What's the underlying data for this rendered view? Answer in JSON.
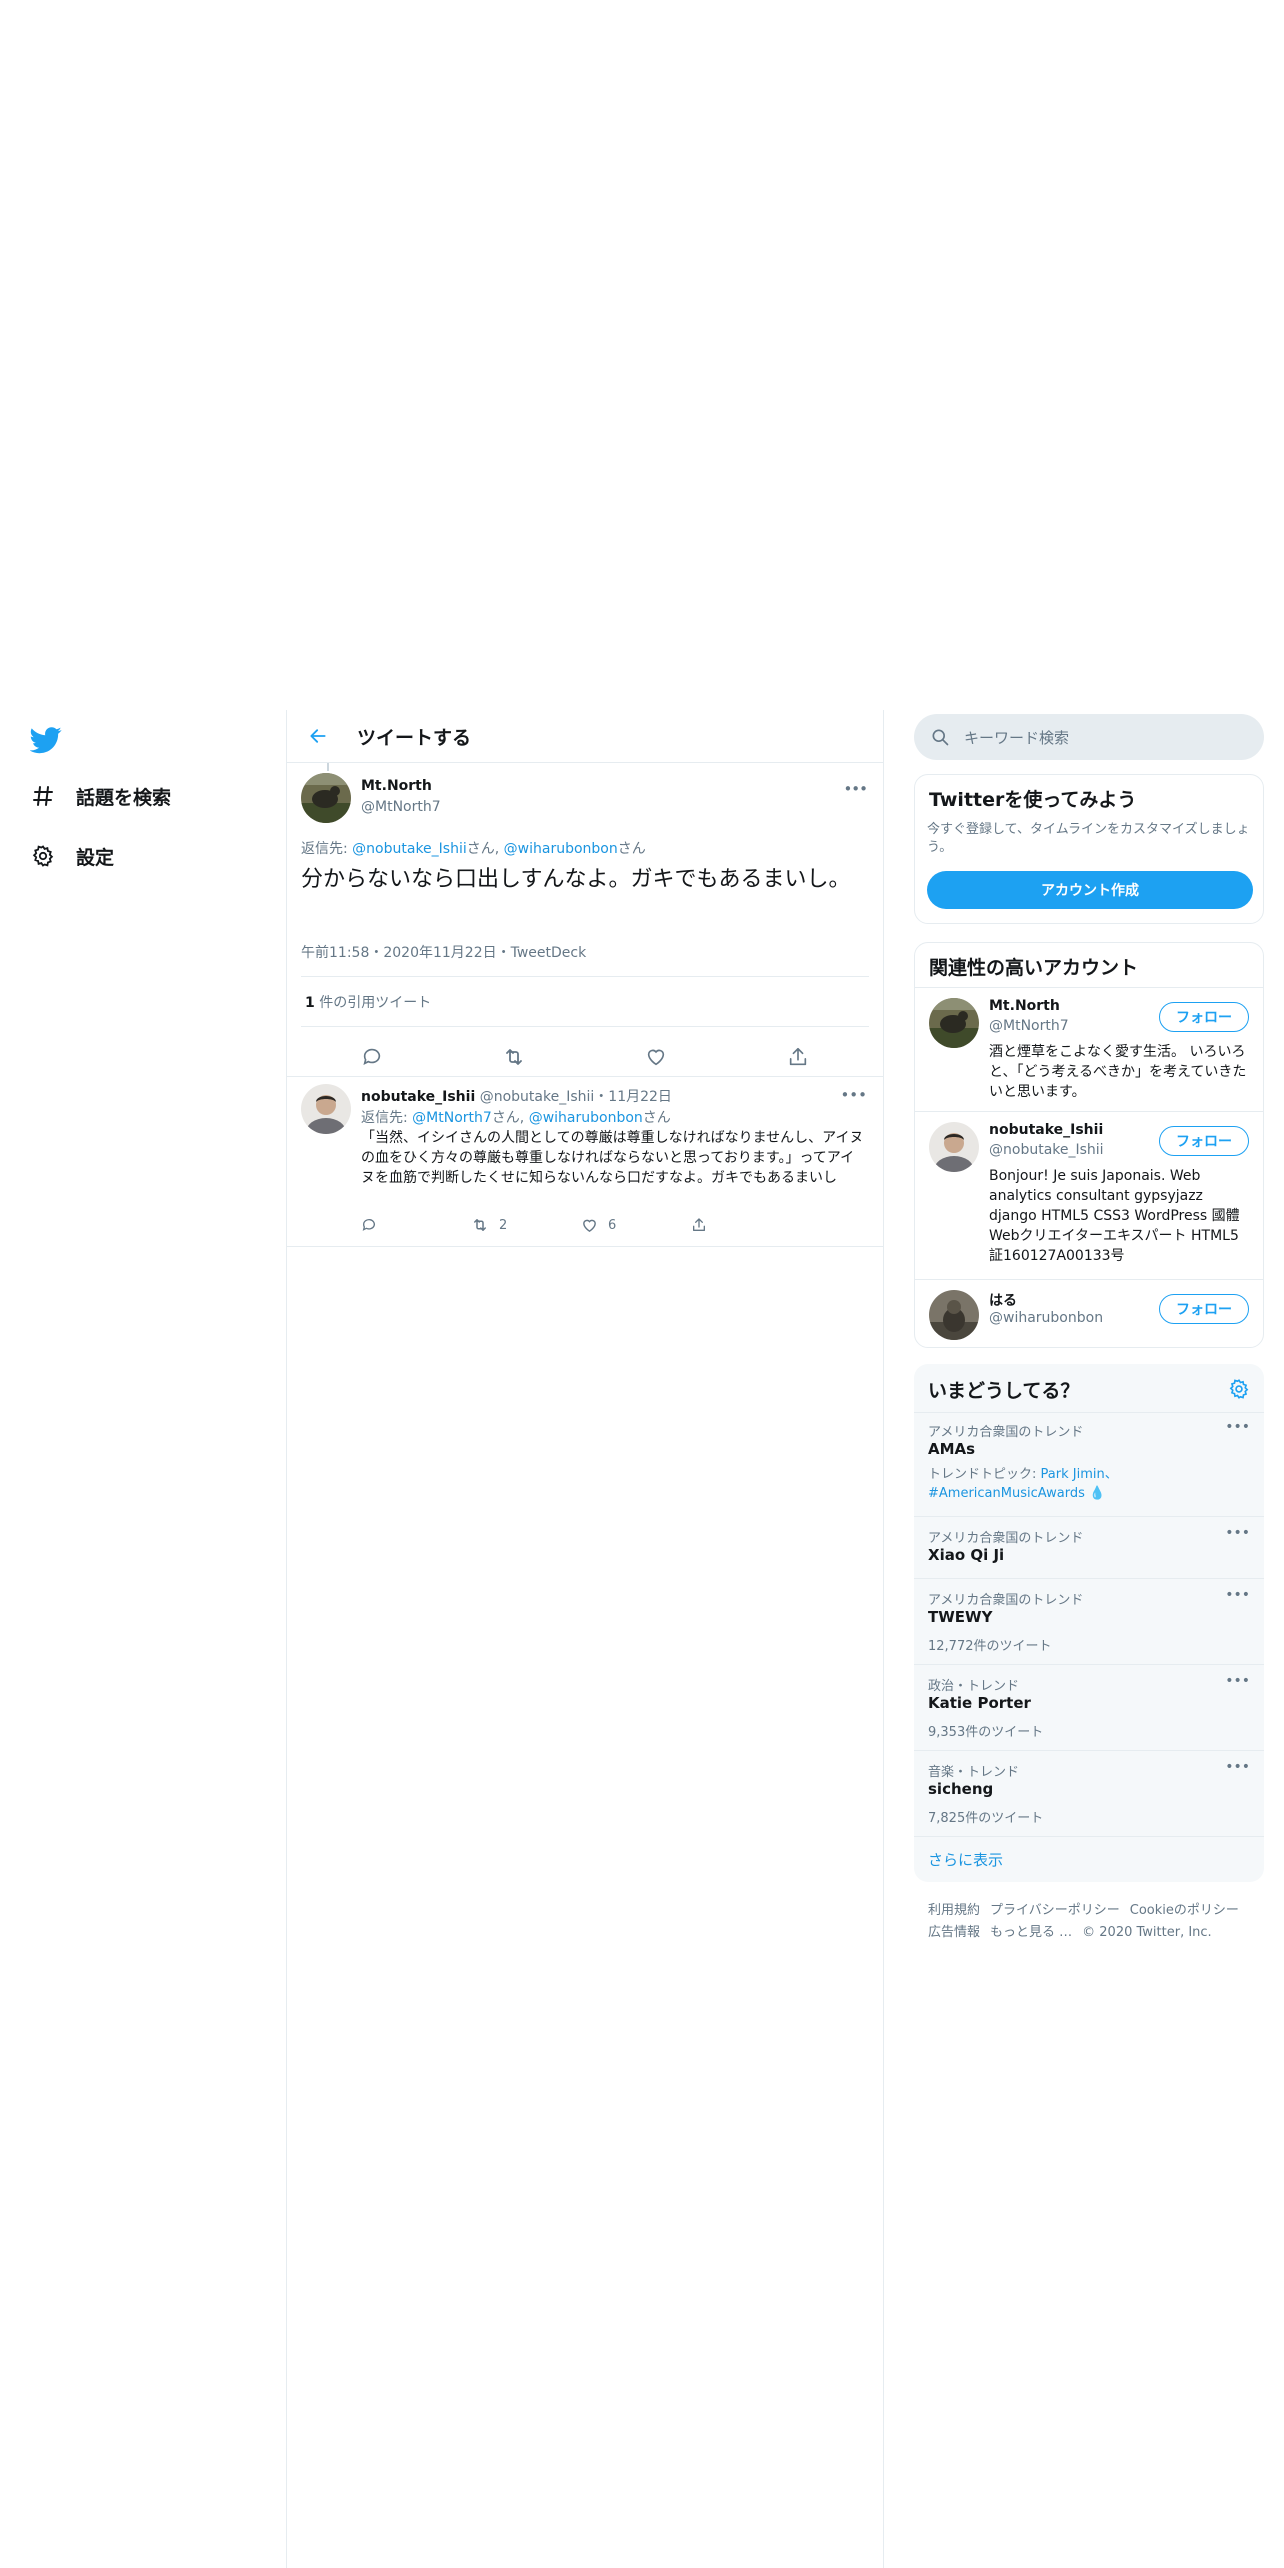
{
  "nav": {
    "explore_label": "話題を検索",
    "settings_label": "設定"
  },
  "header": {
    "title": "ツイートする"
  },
  "tweet": {
    "author_name": "Mt.North",
    "author_handle": "@MtNorth7",
    "reply_prefix": "返信先: ",
    "reply_user1": "@nobutake_Ishii",
    "reply_suffix1": "さん, ",
    "reply_user2": "@wiharubonbon",
    "reply_suffix2": "さん",
    "text": "分からないなら口出しすんなよ。ガキでもあるまいし。",
    "time": "午前11:58",
    "date": "2020年11月22日",
    "client": "TweetDeck",
    "quote_count": "1",
    "quote_label": " 件の引用ツイート"
  },
  "reply": {
    "author_name": "nobutake_Ishii",
    "author_handle": "@nobutake_Ishii",
    "date": "11月22日",
    "reply_prefix": "返信先: ",
    "reply_user1": "@MtNorth7",
    "reply_suffix1": "さん, ",
    "reply_user2": "@wiharubonbon",
    "reply_suffix2": "さん",
    "text": "「当然、イシイさんの人間としての尊厳は尊重しなければなりませんし、アイヌの血をひく方々の尊厳も尊重しなければならないと思っております。」ってアイヌを血筋で判断したくせに知らないんなら口だすなよ。ガキでもあるまいし",
    "retweets": "2",
    "likes": "6"
  },
  "search": {
    "placeholder": "キーワード検索"
  },
  "signup": {
    "title": "Twitterを使ってみよう",
    "desc": "今すぐ登録して、タイムラインをカスタマイズしましょう。",
    "button": "アカウント作成"
  },
  "related": {
    "title": "関連性の高いアカウント",
    "follow_label": "フォロー",
    "accounts": [
      {
        "name": "Mt.North",
        "handle": "@MtNorth7",
        "bio": "酒と煙草をこよなく愛す生活。 いろいろと、「どう考えるべきか」を考えていきたいと思います。"
      },
      {
        "name": "nobutake_Ishii",
        "handle": "@nobutake_Ishii",
        "bio": "Bonjour! Je suis Japonais. Web analytics consultant gypsyjazz django HTML5 CSS3 WordPress 國體 Webクリエイターエキスパート HTML5 証160127A00133号"
      },
      {
        "name": "はる",
        "handle": "@wiharubonbon",
        "bio": ""
      }
    ]
  },
  "trends": {
    "title": "いまどうしてる？",
    "items": [
      {
        "context": "アメリカ合衆国のトレンド",
        "name": "AMAs",
        "topic_prefix": "トレンドトピック: ",
        "topic_links": "Park Jimin、#AmericanMusicAwards",
        "count": ""
      },
      {
        "context": "アメリカ合衆国のトレンド",
        "name": "Xiao Qi Ji",
        "count": ""
      },
      {
        "context": "アメリカ合衆国のトレンド",
        "name": "TWEWY",
        "count": "12,772件のツイート"
      },
      {
        "context": "政治・トレンド",
        "name": "Katie Porter",
        "count": "9,353件のツイート"
      },
      {
        "context": "音楽・トレンド",
        "name": "sicheng",
        "count": "7,825件のツイート"
      }
    ],
    "show_more": "さらに表示"
  },
  "footer": {
    "terms": "利用規約",
    "privacy": "プライバシーポリシー",
    "cookie": "Cookieのポリシー",
    "ads": "広告情報",
    "more": "もっと見る …",
    "copyright": "© 2020 Twitter, Inc."
  },
  "colors": {
    "accent": "#1da1f2",
    "link": "#1b95e0",
    "muted": "#657786"
  }
}
